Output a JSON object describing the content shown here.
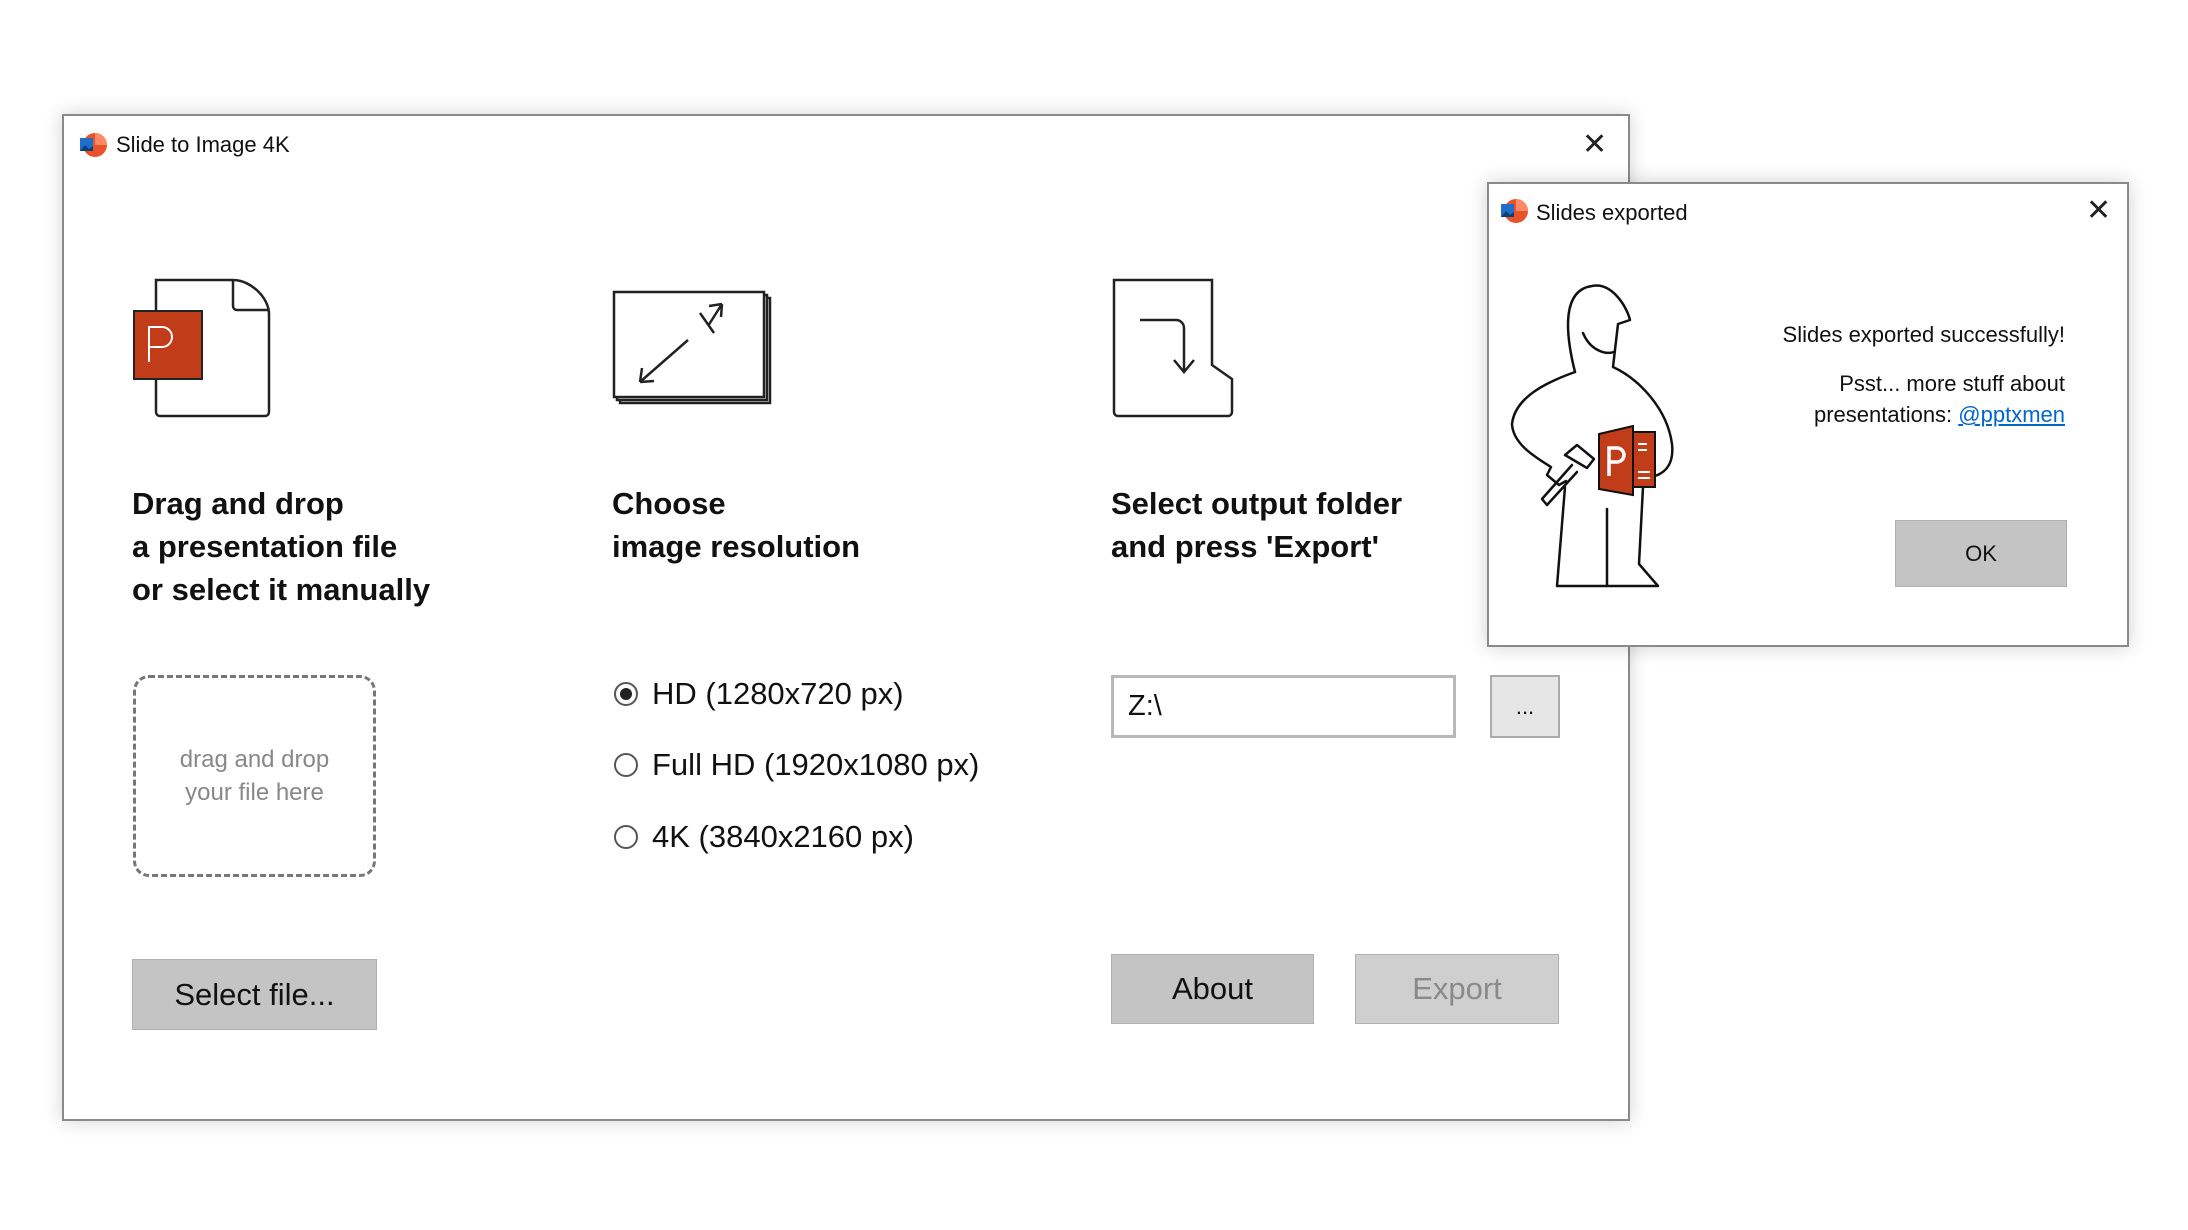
{
  "main_window": {
    "title": "Slide to Image 4K",
    "close_icon": "close-icon",
    "steps": [
      {
        "icon": "powerpoint-file-icon",
        "heading": [
          "Drag and drop",
          "a presentation file",
          "or select it manually"
        ]
      },
      {
        "icon": "resize-icon",
        "heading": [
          "Choose",
          "image resolution"
        ]
      },
      {
        "icon": "export-folder-icon",
        "heading": [
          "Select output folder",
          "and press 'Export'"
        ]
      }
    ],
    "drop_zone": {
      "line1": "drag and drop",
      "line2": "your file here"
    },
    "select_file_label": "Select file...",
    "resolutions": [
      {
        "label": "HD (1280x720 px)",
        "selected": true
      },
      {
        "label": "Full HD (1920x1080 px)",
        "selected": false
      },
      {
        "label": "4K (3840x2160 px)",
        "selected": false
      }
    ],
    "output_path": "Z:\\",
    "browse_label": "...",
    "about_label": "About",
    "export_label": "Export",
    "export_enabled": false
  },
  "dialog": {
    "title": "Slides exported",
    "message": "Slides exported successfully!",
    "promo_line1": "Psst... more stuff about",
    "promo_line2": "presentations: ",
    "link": "@pptxmen",
    "ok_label": "OK",
    "link_color": "#0066cc",
    "accent_color": "#c43e1c"
  }
}
